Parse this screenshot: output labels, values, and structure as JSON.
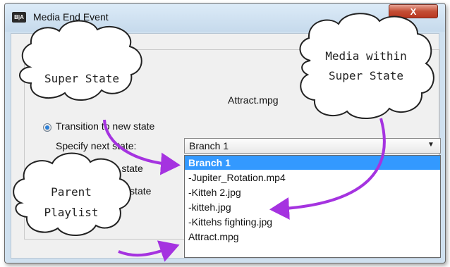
{
  "window": {
    "title": "Media End Event",
    "app_icon": "B|A",
    "close_glyph": "X"
  },
  "content": {
    "media_file": "Attract.mpg",
    "radio_transition_label": "Transition to new state",
    "specify_next_state_label": "Specify next state:",
    "radio_return_label": "Return to prior state",
    "radio_parent_label": "Return to parent state",
    "combo_value": "Branch 1",
    "dropdown_items": [
      "Branch 1",
      "-Jupiter_Rotation.mp4",
      "-Kitteh 2.jpg",
      "-kitteh.jpg",
      "-Kittehs fighting.jpg",
      "Attract.mpg"
    ],
    "dropdown_selected_index": 0
  },
  "annotations": {
    "cloud_super_state": "Super State",
    "cloud_media_line1": "Media within",
    "cloud_media_line2": "Super State",
    "cloud_parent_line1": "Parent",
    "cloud_parent_line2": "Playlist",
    "arrow_color": "#a533e0"
  },
  "icons": {
    "dropdown_arrow": "chevron-down-icon",
    "radio_selected": "radio-selected-icon",
    "radio_unselected": "radio-unselected-icon"
  }
}
